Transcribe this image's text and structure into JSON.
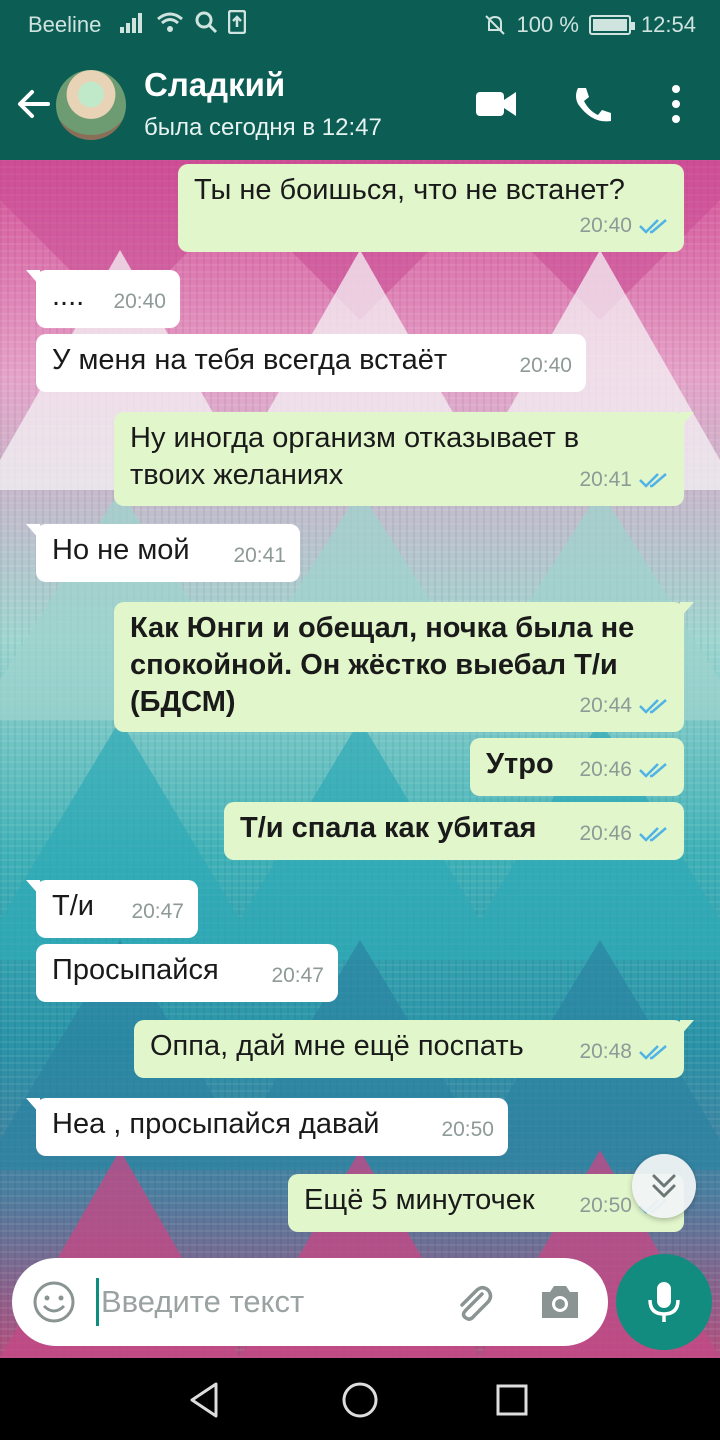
{
  "status_bar": {
    "carrier": "Beeline",
    "battery": "100 %",
    "time": "12:54",
    "icons": [
      "signal-icon",
      "wifi-icon",
      "search-icon",
      "upload-icon",
      "mute-icon",
      "battery-icon"
    ]
  },
  "header": {
    "name": "Сладкий",
    "last_seen": "была сегодня в 12:47",
    "icons": [
      "back-arrow-icon",
      "video-call-icon",
      "phone-icon",
      "more-vert-icon"
    ]
  },
  "messages": [
    {
      "dir": "out",
      "text": "Ты не боишься, что не встанет?",
      "time": "20:40",
      "read": true
    },
    {
      "dir": "in",
      "text": "....",
      "time": "20:40"
    },
    {
      "dir": "in",
      "text": "У меня на тебя всегда встаёт",
      "time": "20:40"
    },
    {
      "dir": "out",
      "text": "Ну иногда организм отказывает в твоих желаниях",
      "time": "20:41",
      "read": true
    },
    {
      "dir": "in",
      "text": "Но не мой",
      "time": "20:41"
    },
    {
      "dir": "out",
      "text": "Как Юнги и обещал, ночка была не спокойной. Он жёстко выебал Т/и (БДСМ)",
      "time": "20:44",
      "read": true,
      "bold": true
    },
    {
      "dir": "out",
      "text": "Утро",
      "time": "20:46",
      "read": true,
      "bold": true
    },
    {
      "dir": "out",
      "text": "Т/и спала как убитая",
      "time": "20:46",
      "read": true,
      "bold": true
    },
    {
      "dir": "in",
      "text": "Т/и",
      "time": "20:47"
    },
    {
      "dir": "in",
      "text": "Просыпайся",
      "time": "20:47"
    },
    {
      "dir": "out",
      "text": "Оппа, дай мне ещё поспать",
      "time": "20:48",
      "read": true
    },
    {
      "dir": "in",
      "text": "Неа , просыпайся давай",
      "time": "20:50"
    },
    {
      "dir": "out",
      "text": "Ещё 5 минуточек",
      "time": "20:50",
      "read": true
    }
  ],
  "composer": {
    "placeholder": "Введите текст",
    "icons": [
      "emoji-icon",
      "attach-icon",
      "camera-icon",
      "mic-icon"
    ]
  },
  "colors": {
    "header": "#0c5e55",
    "outgoing_bubble": "#e1f6cb",
    "incoming_bubble": "#ffffff",
    "read_ticks": "#4fb3e8",
    "mic_button": "#128c7e"
  }
}
